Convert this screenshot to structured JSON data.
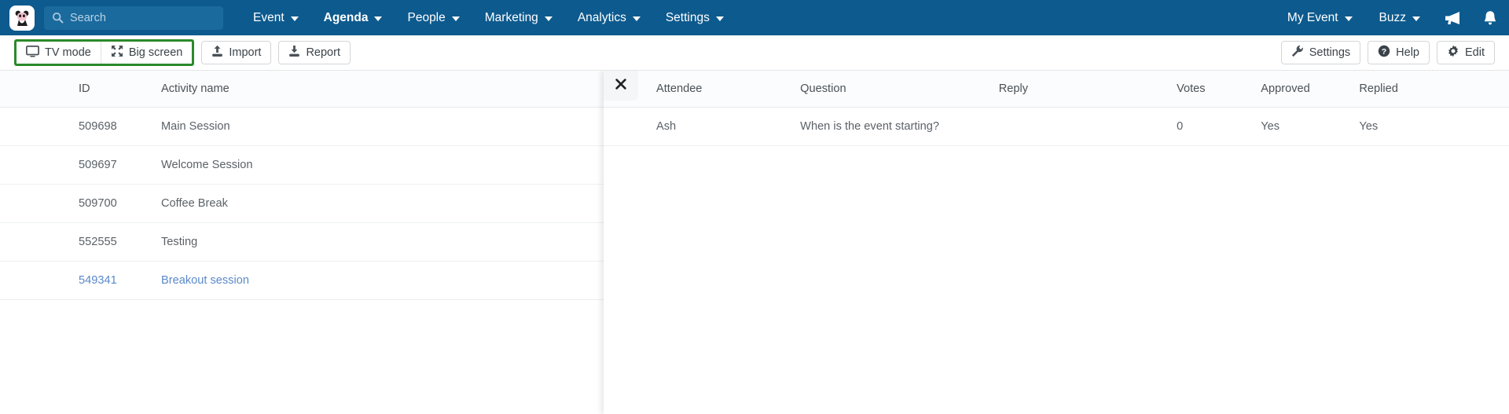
{
  "topnav": {
    "logo_icon": "panda-logo-icon",
    "search": {
      "placeholder": "Search",
      "value": "",
      "icon": "search-icon"
    },
    "items": [
      {
        "label": "Event",
        "active": false
      },
      {
        "label": "Agenda",
        "active": true
      },
      {
        "label": "People",
        "active": false
      },
      {
        "label": "Marketing",
        "active": false
      },
      {
        "label": "Analytics",
        "active": false
      },
      {
        "label": "Settings",
        "active": false
      }
    ],
    "right_items": [
      {
        "label": "My Event"
      },
      {
        "label": "Buzz"
      }
    ],
    "right_icons": [
      {
        "name": "megaphone-icon"
      },
      {
        "name": "bell-notification-icon"
      }
    ],
    "background_color": "#0d5a8e"
  },
  "toolbar": {
    "highlight_color": "#2b8a2b",
    "highlighted_group": [
      {
        "label": "TV mode",
        "icon": "tv-monitor-icon"
      },
      {
        "label": "Big screen",
        "icon": "expand-arrows-icon"
      }
    ],
    "buttons": [
      {
        "label": "Import",
        "icon": "upload-icon"
      },
      {
        "label": "Report",
        "icon": "download-icon"
      }
    ],
    "right_buttons": [
      {
        "label": "Settings",
        "icon": "wrench-icon"
      },
      {
        "label": "Help",
        "icon": "question-circle-icon"
      },
      {
        "label": "Edit",
        "icon": "gear-icon"
      }
    ]
  },
  "activities_table": {
    "columns": [
      "ID",
      "Activity name"
    ],
    "rows": [
      {
        "id": "509698",
        "name": "Main Session",
        "link": false
      },
      {
        "id": "509697",
        "name": "Welcome Session",
        "link": false
      },
      {
        "id": "509700",
        "name": "Coffee Break",
        "link": false
      },
      {
        "id": "552555",
        "name": "Testing",
        "link": false
      },
      {
        "id": "549341",
        "name": "Breakout session",
        "link": true
      }
    ]
  },
  "qa_panel": {
    "close_icon": "close-x-icon",
    "columns": [
      "Attendee",
      "Question",
      "Reply",
      "Votes",
      "Approved",
      "Replied"
    ],
    "rows": [
      {
        "attendee": "Ash",
        "question": "When is the event starting?",
        "reply": "",
        "votes": "0",
        "approved": "Yes",
        "replied": "Yes"
      }
    ],
    "yes_color": "#3f8f3f"
  }
}
